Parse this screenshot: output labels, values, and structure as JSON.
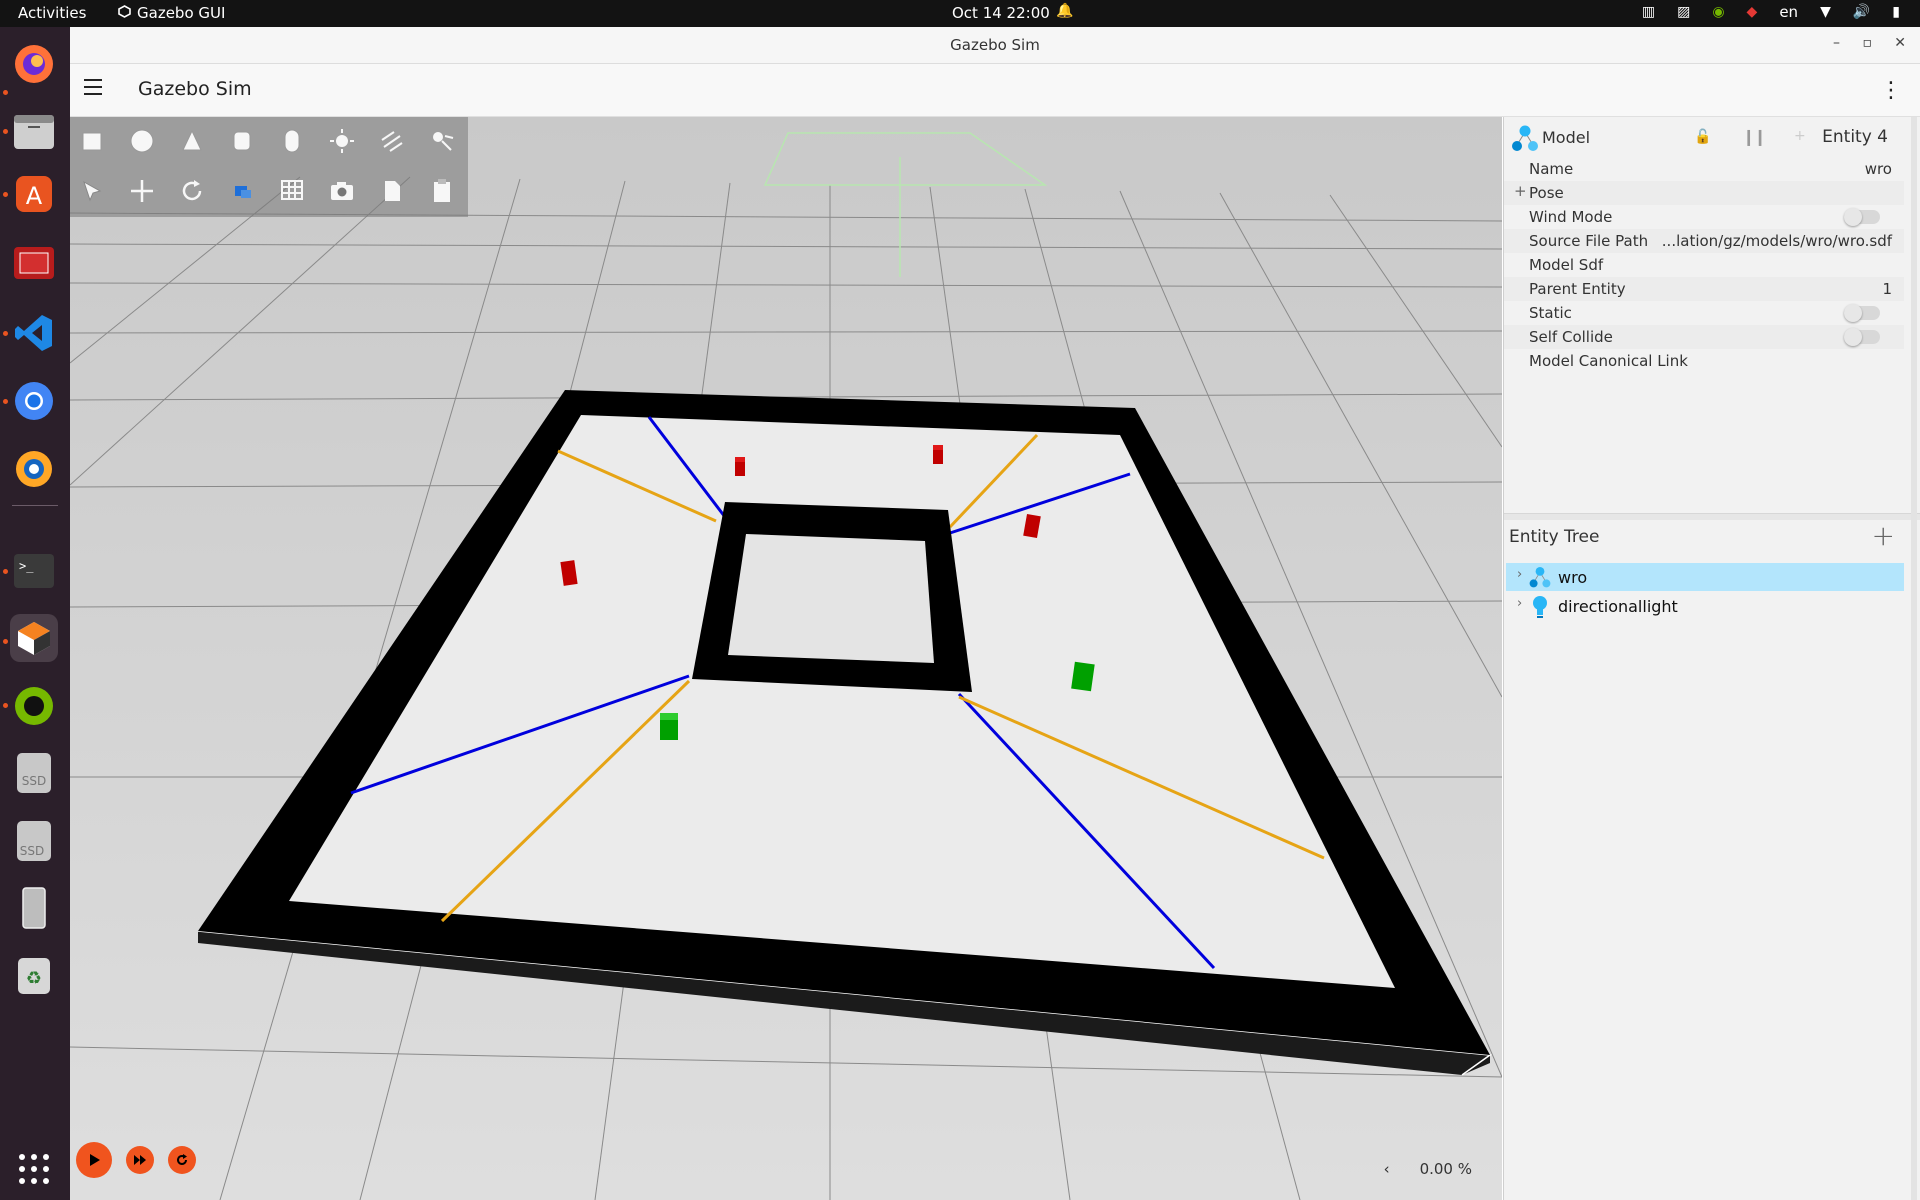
{
  "topbar": {
    "activities": "Activities",
    "app_menu": "Gazebo GUI",
    "clock": "Oct 14  22:00",
    "language": "en"
  },
  "dock": {
    "items": [
      "firefox",
      "files",
      "app-center",
      "system-monitor",
      "vscode",
      "chromium",
      "blender",
      "terminal",
      "gazebo",
      "nvidia-settings",
      "ssd-drive",
      "ssd-drive-2",
      "usb-device",
      "trash",
      "show-apps"
    ],
    "badges": {
      "ssd": "SSD"
    }
  },
  "window": {
    "title": "Gazebo Sim",
    "app_title": "Gazebo Sim"
  },
  "viewport": {
    "progress_label": "0.00 %",
    "prev_label": "‹"
  },
  "component_inspector": {
    "header": "Model",
    "entity_label": "Entity 4",
    "rows": [
      {
        "key": "Name",
        "value": "wro"
      },
      {
        "key": "Pose",
        "value": ""
      },
      {
        "key": "Wind Mode",
        "value": ""
      },
      {
        "key": "Source File Path",
        "value": "...lation/gz/models/wro/wro.sdf"
      },
      {
        "key": "Model Sdf",
        "value": ""
      },
      {
        "key": "Parent Entity",
        "value": "1"
      },
      {
        "key": "Static",
        "value": ""
      },
      {
        "key": "Self Collide",
        "value": ""
      },
      {
        "key": "Model Canonical Link",
        "value": ""
      }
    ],
    "toggles": {
      "wind_mode": false,
      "static": false,
      "self_collide": false
    }
  },
  "entity_tree": {
    "title": "Entity Tree",
    "items": [
      {
        "label": "wro",
        "selected": true
      },
      {
        "label": "directionallight",
        "selected": false
      }
    ]
  },
  "colors": {
    "accent": "#f0541e",
    "selection": "#b3e5fc",
    "track_line_blue": "#0000dd",
    "track_line_orange": "#e6a415",
    "obstacle_red": "#c00000",
    "obstacle_green": "#00a000"
  }
}
